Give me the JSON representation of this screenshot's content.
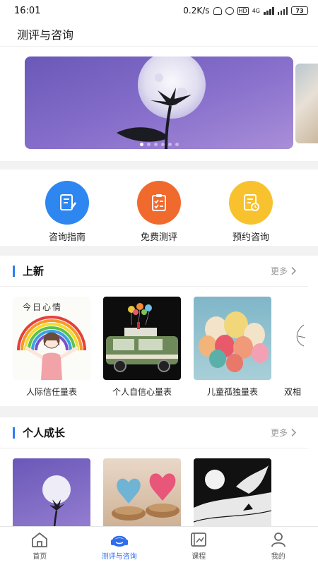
{
  "status_bar": {
    "time": "16:01",
    "net_speed": "0.2K/s",
    "hd_badge": "HD",
    "net_type": "4G",
    "battery": "73"
  },
  "header": {
    "title": "测评与咨询"
  },
  "banner": {
    "slide_count": 6,
    "active_index": 0
  },
  "quick_actions": [
    {
      "label": "咨询指南",
      "icon": "notebook-pen-icon",
      "color": "#2e86f0"
    },
    {
      "label": "免费测评",
      "icon": "clipboard-check-icon",
      "color": "#f06a2e"
    },
    {
      "label": "预约咨询",
      "icon": "document-clock-icon",
      "color": "#f7c22e"
    }
  ],
  "new_section": {
    "title": "上新",
    "more": "更多",
    "items": [
      {
        "label": "人际信任量表",
        "image_text": "今日心情"
      },
      {
        "label": "个人自信心量表"
      },
      {
        "label": "儿童孤独量表"
      },
      {
        "label": "双相"
      }
    ]
  },
  "growth_section": {
    "title": "个人成长",
    "more": "更多"
  },
  "tabbar": [
    {
      "label": "首页",
      "icon": "home-icon"
    },
    {
      "label": "测评与咨询",
      "icon": "headset-icon",
      "active": true
    },
    {
      "label": "课程",
      "icon": "course-icon"
    },
    {
      "label": "我的",
      "icon": "profile-icon"
    }
  ],
  "colors": {
    "accent": "#2e6cf0",
    "section_bar": "#2e7cf6"
  }
}
